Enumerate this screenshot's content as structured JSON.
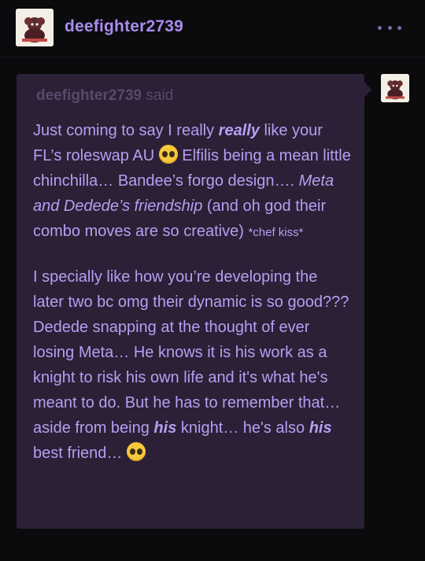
{
  "header": {
    "username": "deefighter2739",
    "avatar_icon": "avatar-icon",
    "more_icon": "more-dots-icon"
  },
  "ask": {
    "asker": "deefighter2739",
    "said": "said",
    "p1": {
      "t1": "Just coming to say I really ",
      "em1": "really",
      "t2": " like your FL’s roleswap AU ",
      "t3": " Elfilis being a mean little chinchilla… Bandee’s forgo design…. ",
      "em2": "Meta and Dedede’s friendship",
      "t4": " (and oh god their combo moves are so creative) ",
      "small": "*chef kiss*"
    },
    "p2": {
      "t1": "I specially like how you’re developing the later two bc omg their dynamic is so good??? Dedede snapping at the thought of ever losing Meta… He knows it is his work as a knight to risk his own life and it's what he's meant to do. But he has to remember that… aside from being ",
      "em1": "his",
      "t2": " knight… he's also ",
      "em2": "his",
      "t3": " best friend… "
    },
    "emoji_icon": "pleading-face-emoji"
  }
}
